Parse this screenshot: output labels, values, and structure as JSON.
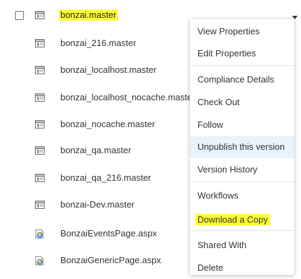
{
  "files": [
    {
      "name": "bonzai.master",
      "icon": "master-page-icon",
      "highlighted": true,
      "show_checkbox": true
    },
    {
      "name": "bonzai_216.master",
      "icon": "master-page-icon"
    },
    {
      "name": "bonzai_localhost.master",
      "icon": "master-page-icon"
    },
    {
      "name": "bonzai_localhost_nocache.master",
      "icon": "master-page-icon"
    },
    {
      "name": "bonzai_nocache.master",
      "icon": "master-page-icon"
    },
    {
      "name": "bonzai_qa.master",
      "icon": "master-page-icon"
    },
    {
      "name": "bonzai_qa_216.master",
      "icon": "master-page-icon"
    },
    {
      "name": "bonzai-Dev.master",
      "icon": "master-page-icon"
    },
    {
      "name": "BonzaiEventsPage.aspx",
      "icon": "ie-page-icon"
    },
    {
      "name": "BonzaiGenericPage.aspx",
      "icon": "ie-page-icon"
    }
  ],
  "context_menu": {
    "groups": [
      [
        "View Properties",
        "Edit Properties"
      ],
      [
        "Compliance Details",
        "Check Out",
        "Follow",
        "Unpublish this version",
        "Version History"
      ],
      [
        "Workflows",
        "Download a Copy"
      ],
      [
        "Shared With",
        "Delete"
      ]
    ],
    "hovered_item": "Unpublish this version",
    "highlighted_item": "Download a Copy"
  },
  "colors": {
    "highlight": "#ffff33",
    "hover": "#e8f3fb",
    "text": "#333333",
    "ie_blue": "#1e73be"
  }
}
